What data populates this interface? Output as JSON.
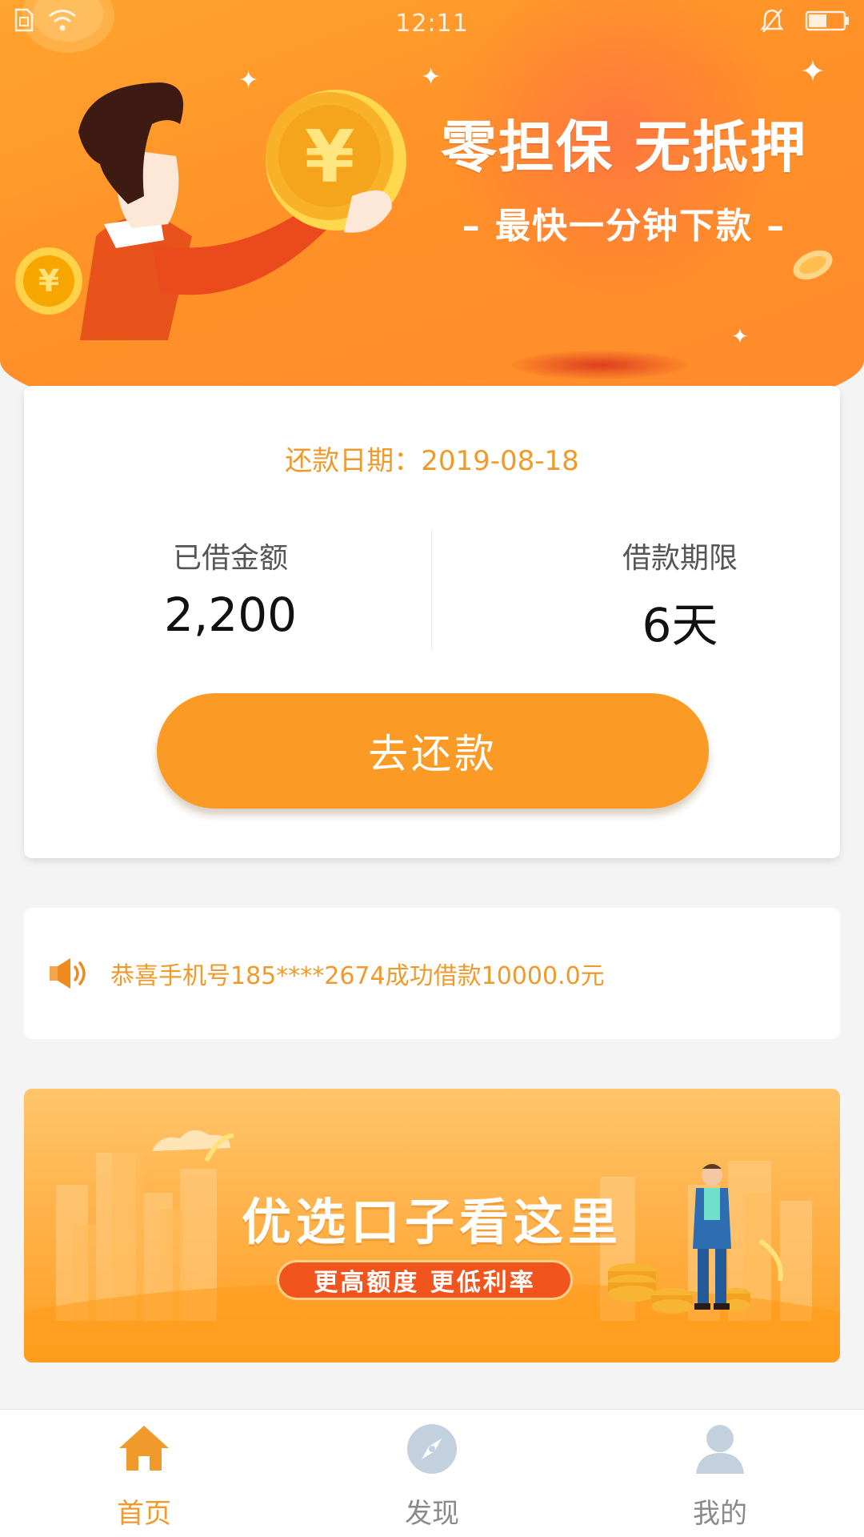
{
  "status_bar": {
    "time": "12:11"
  },
  "hero": {
    "title": "零担保 无抵押",
    "subtitle": "– 最快一分钟下款 –"
  },
  "repay_card": {
    "due_date": "还款日期：2019-08-18",
    "borrowed_label": "已借金额",
    "borrowed_value": "2,200",
    "term_label": "借款期限",
    "term_value": "6天",
    "repay_button": "去还款"
  },
  "notice": {
    "icon": "speaker-icon",
    "text": "恭喜手机号185****2674成功借款10000.0元"
  },
  "promo": {
    "title": "优选口子看这里",
    "tagline": "更高额度 更低利率"
  },
  "tabbar": {
    "tabs": [
      {
        "label": "首页",
        "icon": "home-icon",
        "active": true
      },
      {
        "label": "发现",
        "icon": "compass-icon",
        "active": false
      },
      {
        "label": "我的",
        "icon": "user-icon",
        "active": false
      }
    ]
  },
  "colors": {
    "accent": "#fb9a24",
    "accent_text": "#f19a2c",
    "inactive_icon": "#c3d0de"
  }
}
